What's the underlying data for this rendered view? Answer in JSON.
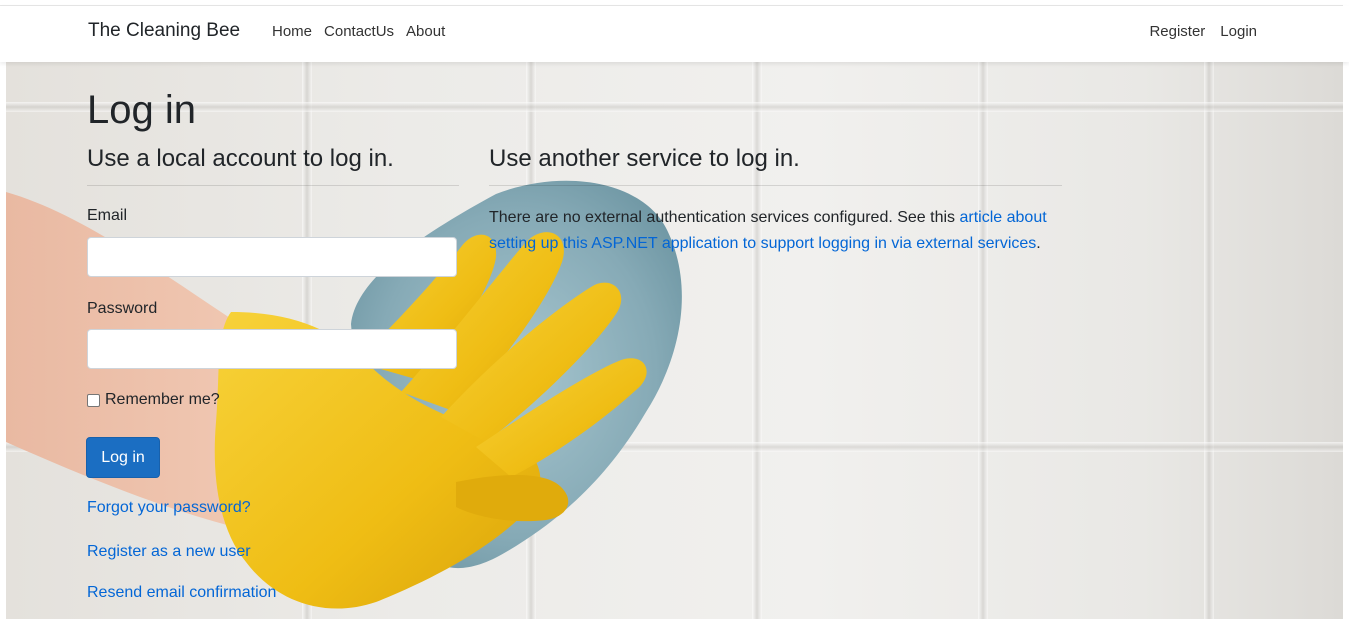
{
  "navbar": {
    "brand": "The Cleaning Bee",
    "links": [
      "Home",
      "ContactUs",
      "About"
    ],
    "right_links": [
      "Register",
      "Login"
    ]
  },
  "page": {
    "title": "Log in",
    "local_heading": "Use a local account to log in.",
    "external_heading": "Use another service to log in.",
    "email_label": "Email",
    "email_value": "",
    "password_label": "Password",
    "password_value": "",
    "remember_label": "Remember me?",
    "remember_checked": false,
    "login_button": "Log in",
    "forgot_link": "Forgot your password?",
    "register_link": "Register as a new user",
    "resend_link": "Resend email confirmation",
    "external_text_before": "There are no external authentication services configured. See this ",
    "external_link": "article about setting up this ASP.NET application to support logging in via external services",
    "external_text_after": "."
  },
  "colors": {
    "link": "#0366d6",
    "primary_button": "#1b6ec2",
    "glove": "#f2c21b",
    "cloth": "#8fb3c0"
  },
  "icons": [
    "checkbox-icon"
  ]
}
